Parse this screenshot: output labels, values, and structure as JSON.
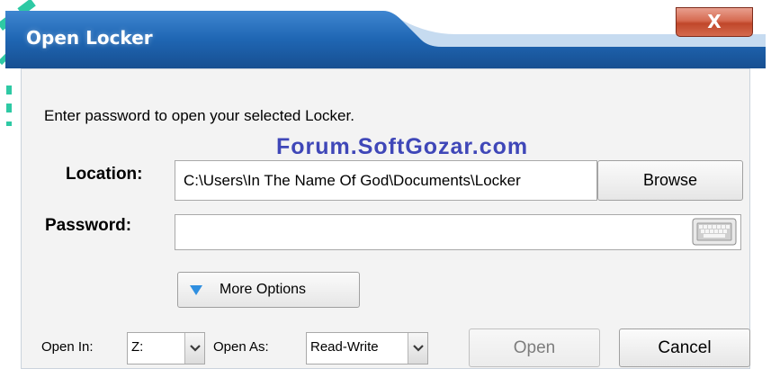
{
  "window": {
    "title": "Open Locker",
    "close_label": "X"
  },
  "main": {
    "instruction": "Enter password to open your selected Locker.",
    "watermark": "Forum.SoftGozar.com",
    "location": {
      "label": "Location:",
      "value": "C:\\Users\\In The Name Of God\\Documents\\Locker",
      "browse_label": "Browse"
    },
    "password": {
      "label": "Password:",
      "value": "",
      "keyboard_icon": "keyboard-icon"
    },
    "more_options_label": "More Options"
  },
  "footer": {
    "open_in": {
      "label": "Open In:",
      "value": "Z:"
    },
    "open_as": {
      "label": "Open As:",
      "value": "Read-Write"
    },
    "open_label": "Open",
    "cancel_label": "Cancel"
  },
  "colors": {
    "title_bar": "#1a5fa6",
    "close_button": "#c7472a",
    "watermark": "#3f47b8"
  }
}
